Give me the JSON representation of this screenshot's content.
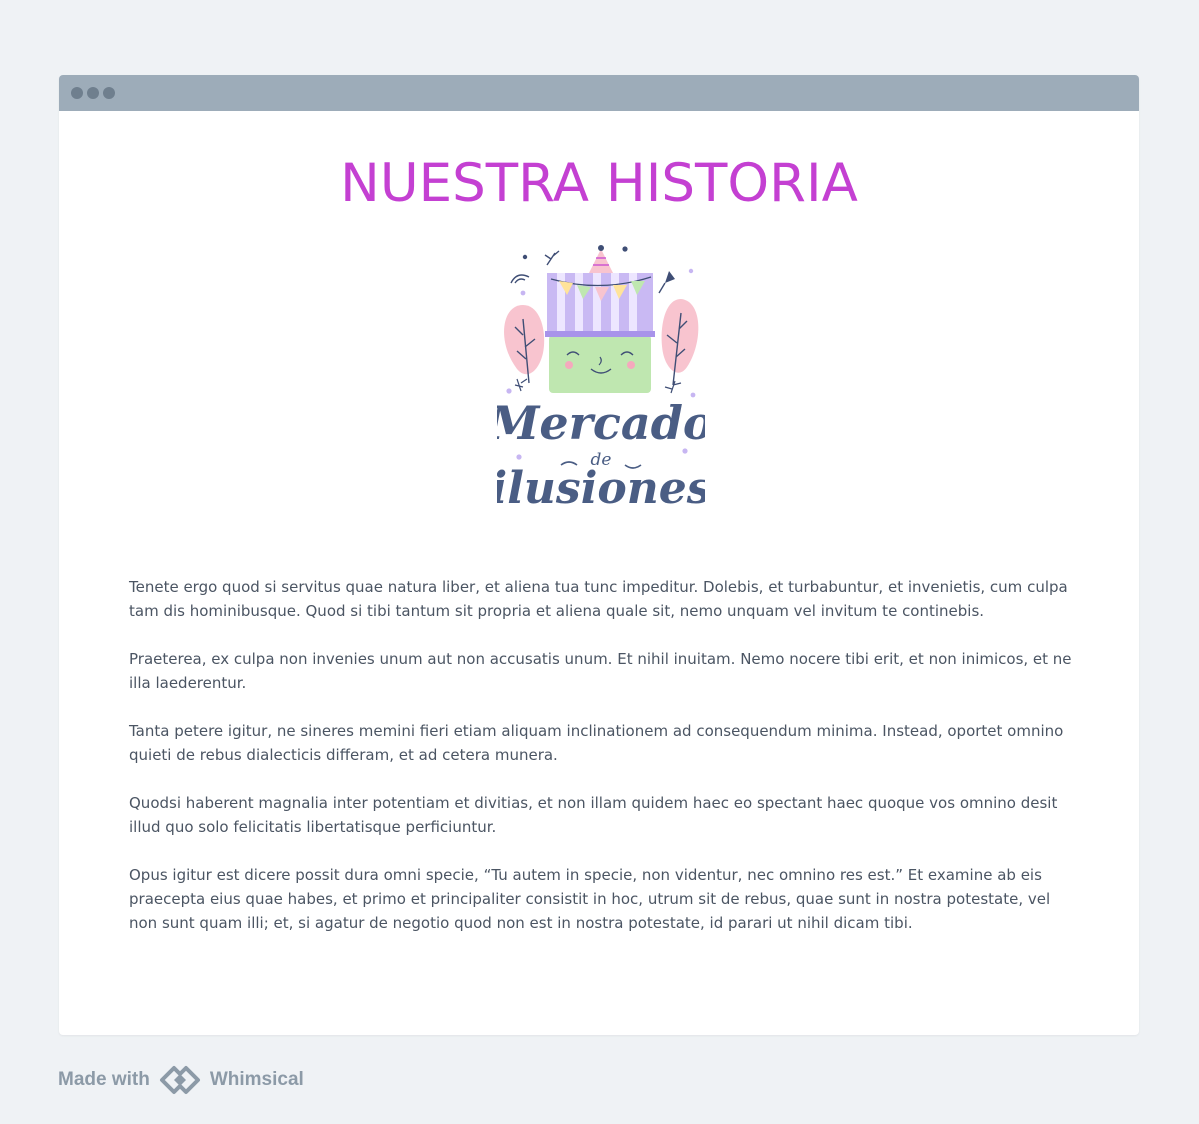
{
  "window": {
    "title": "NUESTRA HISTORIA",
    "logo": {
      "name": "mercado-de-ilusiones-logo",
      "text_line1": "Mercado",
      "text_line2": "de",
      "text_line3": "ilusiones"
    },
    "paragraphs": [
      "Tenete ergo quod si servitus quae natura liber, et aliena tua tunc impeditur. Dolebis, et turbabuntur, et invenietis, cum culpa tam dis hominibusque. Quod si tibi tantum sit propria et aliena quale sit, nemo unquam vel invitum te continebis.",
      "Praeterea, ex culpa non invenies unum aut non accusatis unum. Et nihil inuitam. Nemo nocere tibi erit, et non inimicos, et ne illa laederentur.",
      "Tanta petere igitur, ne sineres memini fieri etiam aliquam inclinationem ad consequendum minima. Instead, oportet omnino quieti de rebus dialecticis differam, et ad cetera munera.",
      "Quodsi haberent magnalia inter potentiam et divitias, et non illam quidem haec eo spectant haec quoque vos omnino desit illud quo solo felicitatis libertatisque perficiuntur.",
      "Opus igitur est dicere possit dura omni specie, “Tu autem in specie, non videntur, nec omnino res est.” Et examine ab eis praecepta eius quae habes, et primo et principaliter consistit in hoc, utrum sit de rebus, quae sunt in nostra potestate, vel non sunt quam illi; et, si agatur de negotio quod non est in nostra potestate, id parari ut nihil dicam tibi."
    ]
  },
  "footer": {
    "made_with": "Made with",
    "brand": "Whimsical"
  },
  "colors": {
    "page_bg": "#eff2f5",
    "window_bar": "#9dacb9",
    "title": "#c440d2",
    "body_text": "#4b5563",
    "footer_text": "#8c9aa7"
  }
}
